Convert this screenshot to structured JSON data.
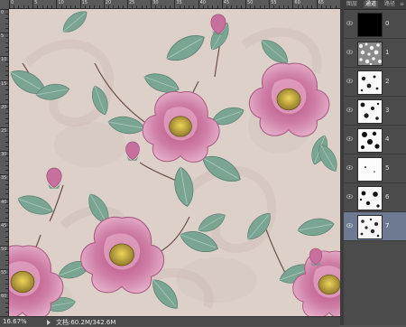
{
  "status": {
    "zoom": "16.67%",
    "document_info": "文档:60.2M/342.6M"
  },
  "rulers": {
    "top_labels": [
      "0",
      "5",
      "10",
      "15",
      "20",
      "25",
      "30",
      "35",
      "40",
      "45",
      "50",
      "55",
      "60",
      "65"
    ],
    "left_labels": [
      "0",
      "5",
      "10",
      "15",
      "20",
      "25",
      "30",
      "35",
      "40",
      "45",
      "50",
      "55",
      "60"
    ]
  },
  "panel": {
    "tabs": [
      {
        "label": "图层",
        "active": false
      },
      {
        "label": "通道",
        "active": true
      },
      {
        "label": "路径",
        "active": false
      }
    ],
    "menu_icon": "panel-menu-icon",
    "channels": [
      {
        "label": "0",
        "selected": false,
        "visible": true
      },
      {
        "label": "1",
        "selected": false,
        "visible": true
      },
      {
        "label": "2",
        "selected": false,
        "visible": true
      },
      {
        "label": "3",
        "selected": false,
        "visible": true
      },
      {
        "label": "4",
        "selected": false,
        "visible": true
      },
      {
        "label": "5",
        "selected": false,
        "visible": true
      },
      {
        "label": "6",
        "selected": false,
        "visible": true
      },
      {
        "label": "7",
        "selected": true,
        "visible": true
      }
    ]
  },
  "colors": {
    "canvas_background": "#ddd0c9",
    "flower_pink": "#c96f9b",
    "flower_light": "#e3a5c3",
    "leaf_green": "#6f9a88",
    "stem_brown": "#6b5048",
    "selected_row": "#6d7a92"
  }
}
